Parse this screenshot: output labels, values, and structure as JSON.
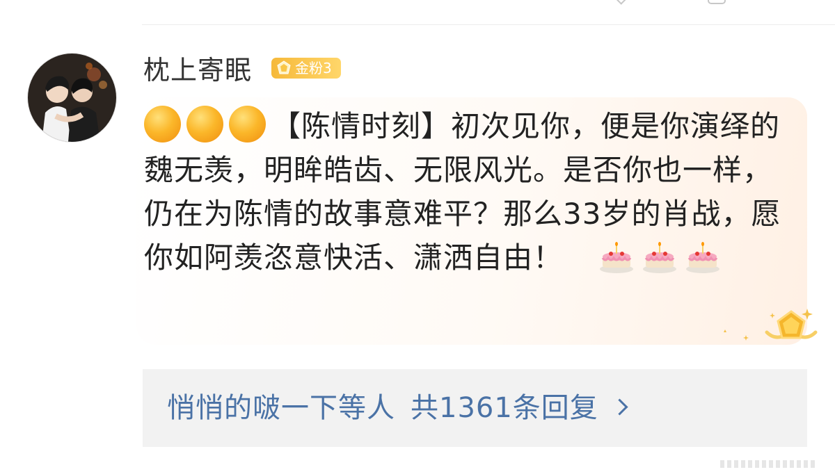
{
  "comment": {
    "username": "枕上寄眠",
    "fan_badge": "金粉3",
    "emoji_prefix": [
      "orange-circle",
      "orange-circle",
      "orange-circle"
    ],
    "text": "【陈情时刻】初次见你，便是你演绎的魏无羡，明眸皓齿、无限风光。是否你也一样，仍在为陈情的故事意难平？那么33岁的肖战，愿你如阿羡恣意快活、潇洒自由！",
    "emoji_suffix": [
      "birthday-cake",
      "birthday-cake",
      "birthday-cake"
    ]
  },
  "replies": {
    "summary": "悄悄的啵一下等人",
    "count": "共1361条回复"
  },
  "colors": {
    "link_blue": "#4a72a6",
    "badge_gold": "#f6b93a"
  }
}
